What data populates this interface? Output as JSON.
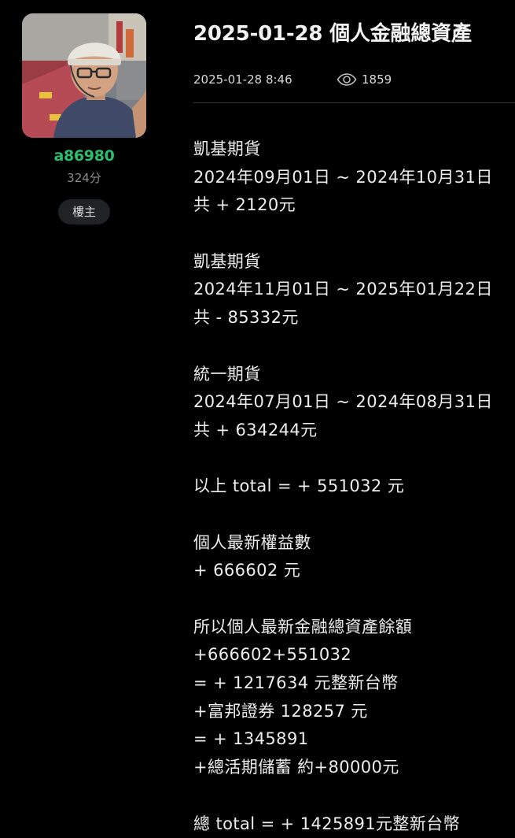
{
  "author": {
    "username": "a86980",
    "score": "324分",
    "badge": "樓主"
  },
  "post": {
    "title": "2025-01-28 個人金融總資產",
    "date": "2025-01-28 8:46",
    "view_count": "1859",
    "body_lines": [
      "凱基期貨",
      "2024年09月01日 ~ 2024年10月31日",
      "共 + 2120元",
      "",
      "凱基期貨",
      "2024年11月01日 ~ 2025年01月22日",
      "共 - 85332元",
      "",
      "統一期貨",
      "2024年07月01日 ~ 2024年08月31日",
      "共 + 634244元",
      "",
      "以上 total = + 551032 元",
      "",
      "個人最新權益數",
      "+ 666602 元",
      "",
      "所以個人最新金融總資產餘額",
      "+666602+551032",
      "= + 1217634 元整新台幣",
      "+富邦證券 128257 元",
      "= + 1345891",
      "+總活期儲蓄 約+80000元",
      "",
      "總 total = + 1425891元整新台幣"
    ]
  },
  "colors": {
    "background": "#000000",
    "username": "#2dbd6e",
    "badge_bg": "#1f2326",
    "divider": "#333333"
  },
  "icons": {
    "views": "eye-icon",
    "avatar": "user-avatar-photo"
  }
}
